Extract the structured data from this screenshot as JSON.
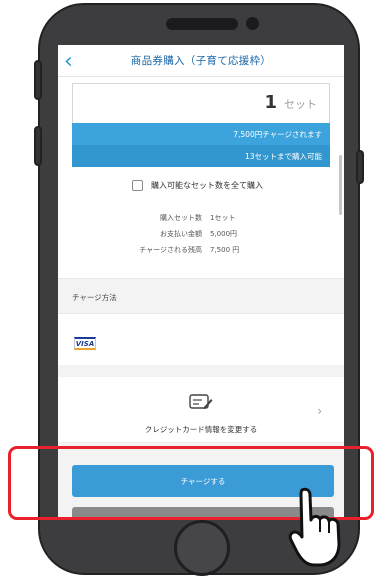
{
  "nav": {
    "back_icon": "‹",
    "title": "商品券購入（子育て応援枠）"
  },
  "quantity": {
    "value": "1",
    "unit": "セット"
  },
  "info_rows": {
    "charge_amount": "7,500円チャージされます",
    "max_sets": "13セットまで購入可能"
  },
  "buy_all": {
    "label": "購入可能なセット数を全て購入",
    "checked": false
  },
  "summary": [
    {
      "label": "購入セット数",
      "value": "1セット"
    },
    {
      "label": "お支払い金額",
      "value": "5,000円"
    },
    {
      "label": "チャージされる残高",
      "value": "7,500 円"
    }
  ],
  "payment": {
    "section_title": "チャージ方法",
    "card_brand": "VISA"
  },
  "card_change": {
    "icon": "credit-card-edit-icon",
    "label": "クレジットカード情報を変更する",
    "chevron": "›"
  },
  "buttons": {
    "charge": "チャージする"
  },
  "colors": {
    "accent": "#3b9bd6",
    "highlight": "#e8212a",
    "phone_body": "#3d3d40"
  }
}
